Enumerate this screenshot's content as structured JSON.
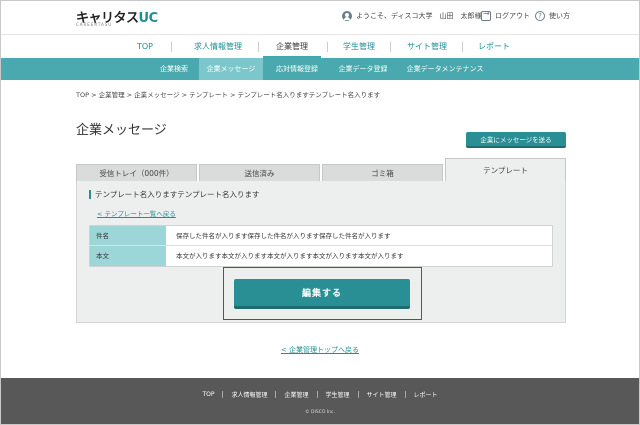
{
  "header": {
    "logo_main": "キャリタス",
    "logo_accent": "UC",
    "logo_sub": "CAREERTASU",
    "greeting": "ようこそ、ディスコ大学　山田　太郎様",
    "logout": "ログアウト",
    "help": "使い方"
  },
  "mainnav": {
    "items": [
      "TOP",
      "求人情報管理",
      "企業管理",
      "学生管理",
      "サイト管理",
      "レポート"
    ],
    "active": "企業管理"
  },
  "subnav": {
    "items": [
      "企業検索",
      "企業メッセージ",
      "応対情報登録",
      "企業データ登録",
      "企業データメンテナンス"
    ],
    "active": "企業メッセージ"
  },
  "breadcrumb": "TOP > 企業管理 > 企業メッセージ > テンプレート > テンプレート名入りますテンプレート名入ります",
  "page": {
    "title": "企業メッセージ",
    "send_button": "企業にメッセージを送る"
  },
  "tabs": [
    "受信トレイ（000件）",
    "送信済み",
    "ゴミ箱",
    "テンプレート"
  ],
  "panel": {
    "title": "テンプレート名入りますテンプレート名入ります",
    "back_link": "< テンプレート一覧へ戻る",
    "rows": [
      {
        "label": "件名",
        "value": "保存した件名が入ります保存した件名が入ります保存した件名が入ります"
      },
      {
        "label": "本文",
        "value": "本文が入ります本文が入ります本文が入ります本文が入ります本文が入ります"
      }
    ],
    "edit_button": "編集する"
  },
  "footer_link": "< 企業管理トップへ戻る",
  "footer": {
    "items": [
      "TOP",
      "求人情報管理",
      "企業管理",
      "学生管理",
      "サイト管理",
      "レポート"
    ],
    "copyright": "© DISCO Inc."
  },
  "colors": {
    "accent": "#2a8f94",
    "subnav": "#4aa9ae",
    "highlight": "#c8252b",
    "footer": "#585858"
  }
}
